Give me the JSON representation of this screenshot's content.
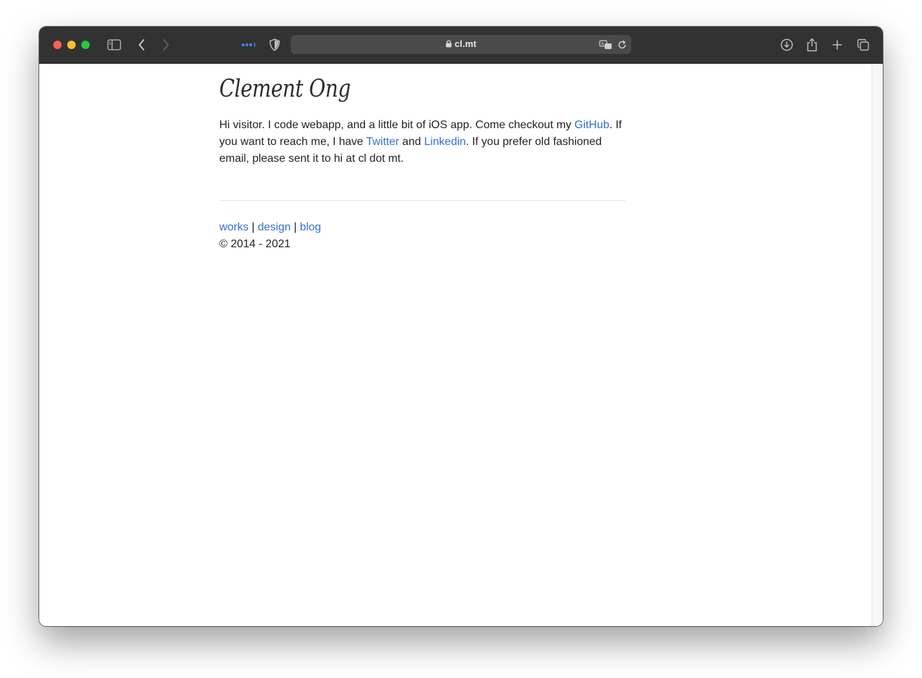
{
  "browser": {
    "url": "cl.mt"
  },
  "page": {
    "title": "Clement Ong",
    "intro": {
      "part1": "Hi visitor. I code webapp, and a little bit of iOS app. Come checkout my ",
      "github_link": "GitHub",
      "part2": ". If you want to reach me, I have ",
      "twitter_link": "Twitter",
      "part3": " and ",
      "linkedin_link": "Linkedin",
      "part4": ". If you prefer old fashioned email, please sent it to hi at cl dot mt."
    },
    "footer": {
      "links": [
        "works",
        "design",
        "blog"
      ],
      "separator": " | ",
      "copyright": "© 2014 - 2021"
    }
  },
  "colors": {
    "link": "#2f6fd6",
    "toolbar": "#323233",
    "address_bar": "#4a4a4b"
  },
  "icons": [
    "sidebar-icon",
    "back-icon",
    "forward-icon",
    "tab-overview-dots-icon",
    "privacy-shield-icon",
    "lock-icon",
    "translate-icon",
    "reload-icon",
    "download-icon",
    "share-icon",
    "new-tab-icon",
    "tabs-icon"
  ]
}
